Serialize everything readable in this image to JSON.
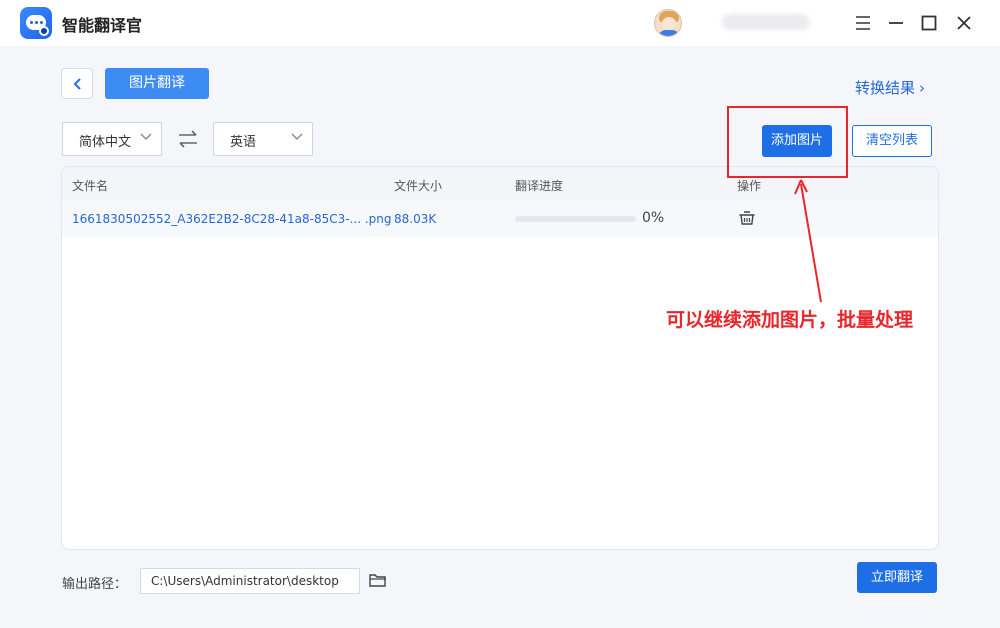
{
  "app": {
    "title": "智能翻译官"
  },
  "toolbar": {
    "tab_label": "图片翻译",
    "result_link": "转换结果"
  },
  "languages": {
    "source": "简体中文",
    "target": "英语"
  },
  "actions": {
    "add_label": "添加图片",
    "clear_label": "清空列表",
    "translate_label": "立即翻译"
  },
  "table": {
    "headers": [
      "文件名",
      "文件大小",
      "翻译进度",
      "操作"
    ],
    "rows": [
      {
        "filename": "1661830502552_A362E2B2-8C28-41a8-85C3-... .png",
        "size": "88.03K",
        "progress": 0,
        "progress_text": "0%"
      }
    ]
  },
  "annotation": {
    "text": "可以继续添加图片，批量处理",
    "color": "#e8262b"
  },
  "output": {
    "label": "输出路径：",
    "path": "C:\\Users\\Administrator\\desktop"
  },
  "colors": {
    "accent": "#1e6fe6",
    "link": "#2567d6",
    "highlight": "#e8262b"
  },
  "icons": [
    "app-logo",
    "avatar",
    "minimize-icon",
    "maximize-icon",
    "close-icon",
    "back-arrow-icon",
    "swap-icon",
    "chevron-down-icon",
    "delete-basket-icon",
    "folder-icon"
  ]
}
